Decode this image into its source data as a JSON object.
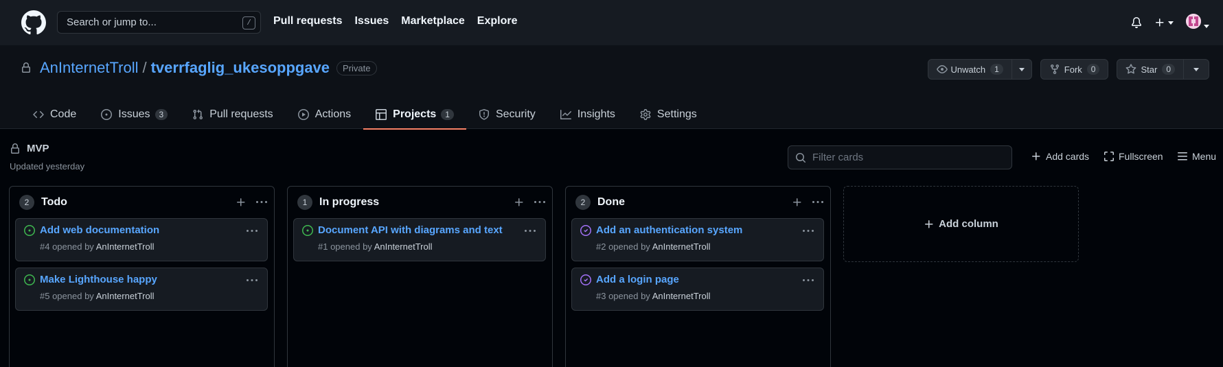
{
  "header": {
    "search_placeholder": "Search or jump to...",
    "search_key": "/",
    "nav": [
      "Pull requests",
      "Issues",
      "Marketplace",
      "Explore"
    ]
  },
  "repo": {
    "owner": "AnInternetTroll",
    "separator": "/",
    "name": "tverrfaglig_ukesoppgave",
    "visibility": "Private",
    "unwatch_label": "Unwatch",
    "unwatch_count": "1",
    "fork_label": "Fork",
    "fork_count": "0",
    "star_label": "Star",
    "star_count": "0"
  },
  "tabs": [
    {
      "label": "Code",
      "icon": "code-icon"
    },
    {
      "label": "Issues",
      "icon": "issue-icon",
      "count": "3"
    },
    {
      "label": "Pull requests",
      "icon": "pull-request-icon"
    },
    {
      "label": "Actions",
      "icon": "play-icon"
    },
    {
      "label": "Projects",
      "icon": "project-icon",
      "count": "1",
      "active": true
    },
    {
      "label": "Security",
      "icon": "shield-icon"
    },
    {
      "label": "Insights",
      "icon": "graph-icon"
    },
    {
      "label": "Settings",
      "icon": "gear-icon"
    }
  ],
  "project": {
    "name": "MVP",
    "updated": "Updated yesterday",
    "filter_placeholder": "Filter cards",
    "add_cards": "Add cards",
    "fullscreen": "Fullscreen",
    "menu": "Menu"
  },
  "columns": [
    {
      "title": "Todo",
      "count": "2",
      "cards": [
        {
          "title": "Add web documentation",
          "meta": "#4 opened by",
          "user": "AnInternetTroll",
          "state": "open"
        },
        {
          "title": "Make Lighthouse happy",
          "meta": "#5 opened by",
          "user": "AnInternetTroll",
          "state": "open"
        }
      ]
    },
    {
      "title": "In progress",
      "count": "1",
      "cards": [
        {
          "title": "Document API with diagrams and text",
          "meta": "#1 opened by",
          "user": "AnInternetTroll",
          "state": "open"
        }
      ]
    },
    {
      "title": "Done",
      "count": "2",
      "cards": [
        {
          "title": "Add an authentication system",
          "meta": "#2 opened by",
          "user": "AnInternetTroll",
          "state": "closed"
        },
        {
          "title": "Add a login page",
          "meta": "#3 opened by",
          "user": "AnInternetTroll",
          "state": "closed"
        }
      ]
    }
  ],
  "add_column": "Add column",
  "colors": {
    "accent": "#58a6ff",
    "open": "#3fb950",
    "closed": "#a371f7",
    "tab_underline": "#f78166"
  }
}
